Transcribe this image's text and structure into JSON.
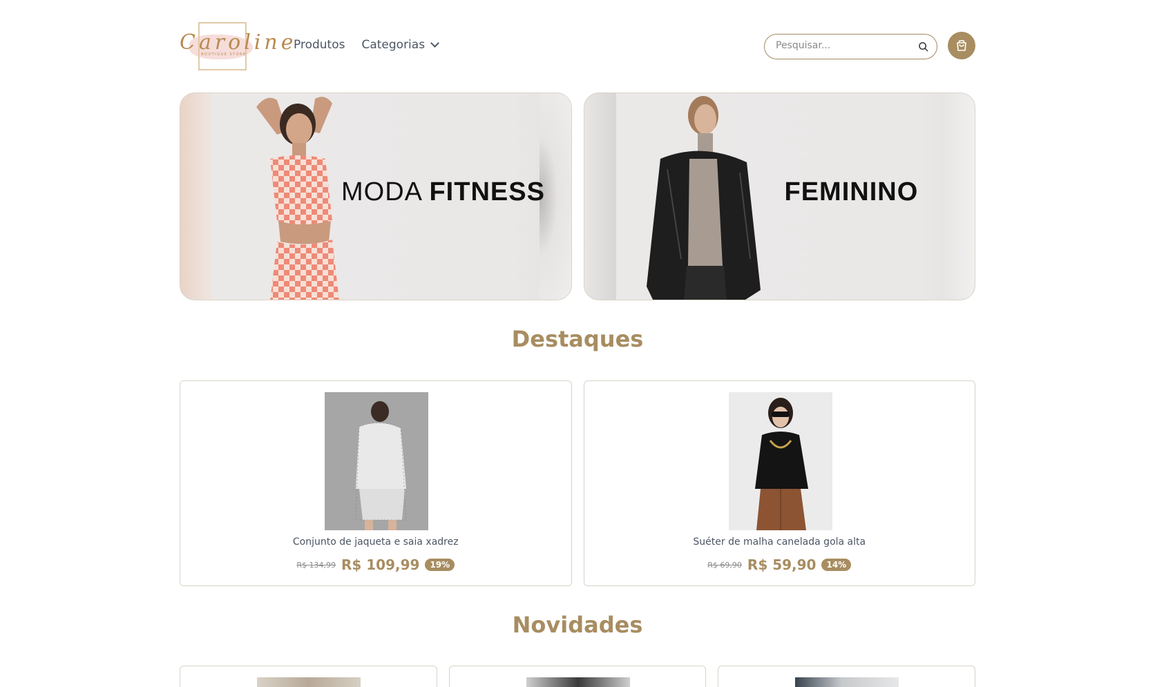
{
  "brand": {
    "name": "Caroline",
    "tagline": "BOUTIQUE STORE"
  },
  "nav": {
    "produtos": "Produtos",
    "categorias": "Categorias"
  },
  "search": {
    "placeholder": "Pesquisar..."
  },
  "icons": {
    "search": "search-icon",
    "cart": "shopping-bag-icon",
    "dropdown": "chevron-down-icon"
  },
  "banners": [
    {
      "title_light": "MODA",
      "title_bold": "FITNESS"
    },
    {
      "title_light": "",
      "title_bold": "FEMININO"
    }
  ],
  "sections": {
    "featured": "Destaques",
    "new": "Novidades"
  },
  "featured_products": [
    {
      "name": "Conjunto de jaqueta e saia xadrez",
      "old_price": "R$ 134,99",
      "price": "R$ 109,99",
      "discount": "19%"
    },
    {
      "name": "Suéter de malha canelada gola alta",
      "old_price": "R$ 69,90",
      "price": "R$ 59,90",
      "discount": "14%"
    }
  ],
  "colors": {
    "accent": "#a88d61",
    "border": "#d9d3c8",
    "text": "#4b5563"
  }
}
